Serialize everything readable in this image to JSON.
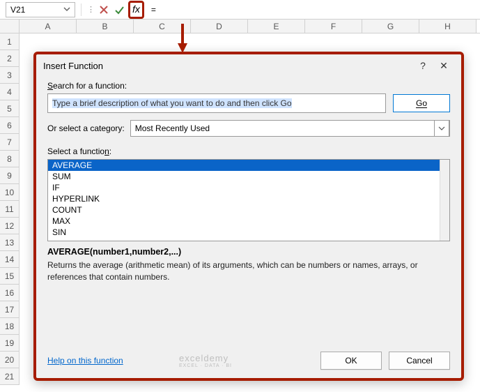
{
  "formula_bar": {
    "name_box": "V21",
    "cancel_icon": "cancel-icon",
    "enter_icon": "enter-icon",
    "fx_label": "fx",
    "formula_value": "="
  },
  "columns": [
    "A",
    "B",
    "C",
    "D",
    "E",
    "F",
    "G",
    "H"
  ],
  "rows": [
    "1",
    "2",
    "3",
    "4",
    "5",
    "6",
    "7",
    "8",
    "9",
    "10",
    "11",
    "12",
    "13",
    "14",
    "15",
    "16",
    "17",
    "18",
    "19",
    "20",
    "21"
  ],
  "dialog": {
    "title": "Insert Function",
    "help_char": "?",
    "close_char": "✕",
    "search_label": "Search for a function:",
    "search_value": "Type a brief description of what you want to do and then click Go",
    "go_label": "Go",
    "category_label": "Or select a category:",
    "category_value": "Most Recently Used",
    "select_label": "Select a function:",
    "functions": [
      "AVERAGE",
      "SUM",
      "IF",
      "HYPERLINK",
      "COUNT",
      "MAX",
      "SIN"
    ],
    "signature": "AVERAGE(number1,number2,...)",
    "description": "Returns the average (arithmetic mean) of its arguments, which can be numbers or names, arrays, or references that contain numbers.",
    "help_link": "Help on this function",
    "ok_label": "OK",
    "cancel_label": "Cancel"
  },
  "watermark": {
    "brand": "exceldemy",
    "tagline": "EXCEL · DATA · BI"
  },
  "colors": {
    "callout": "#a61c00",
    "selection": "#0a64c8",
    "link": "#0066cc"
  }
}
